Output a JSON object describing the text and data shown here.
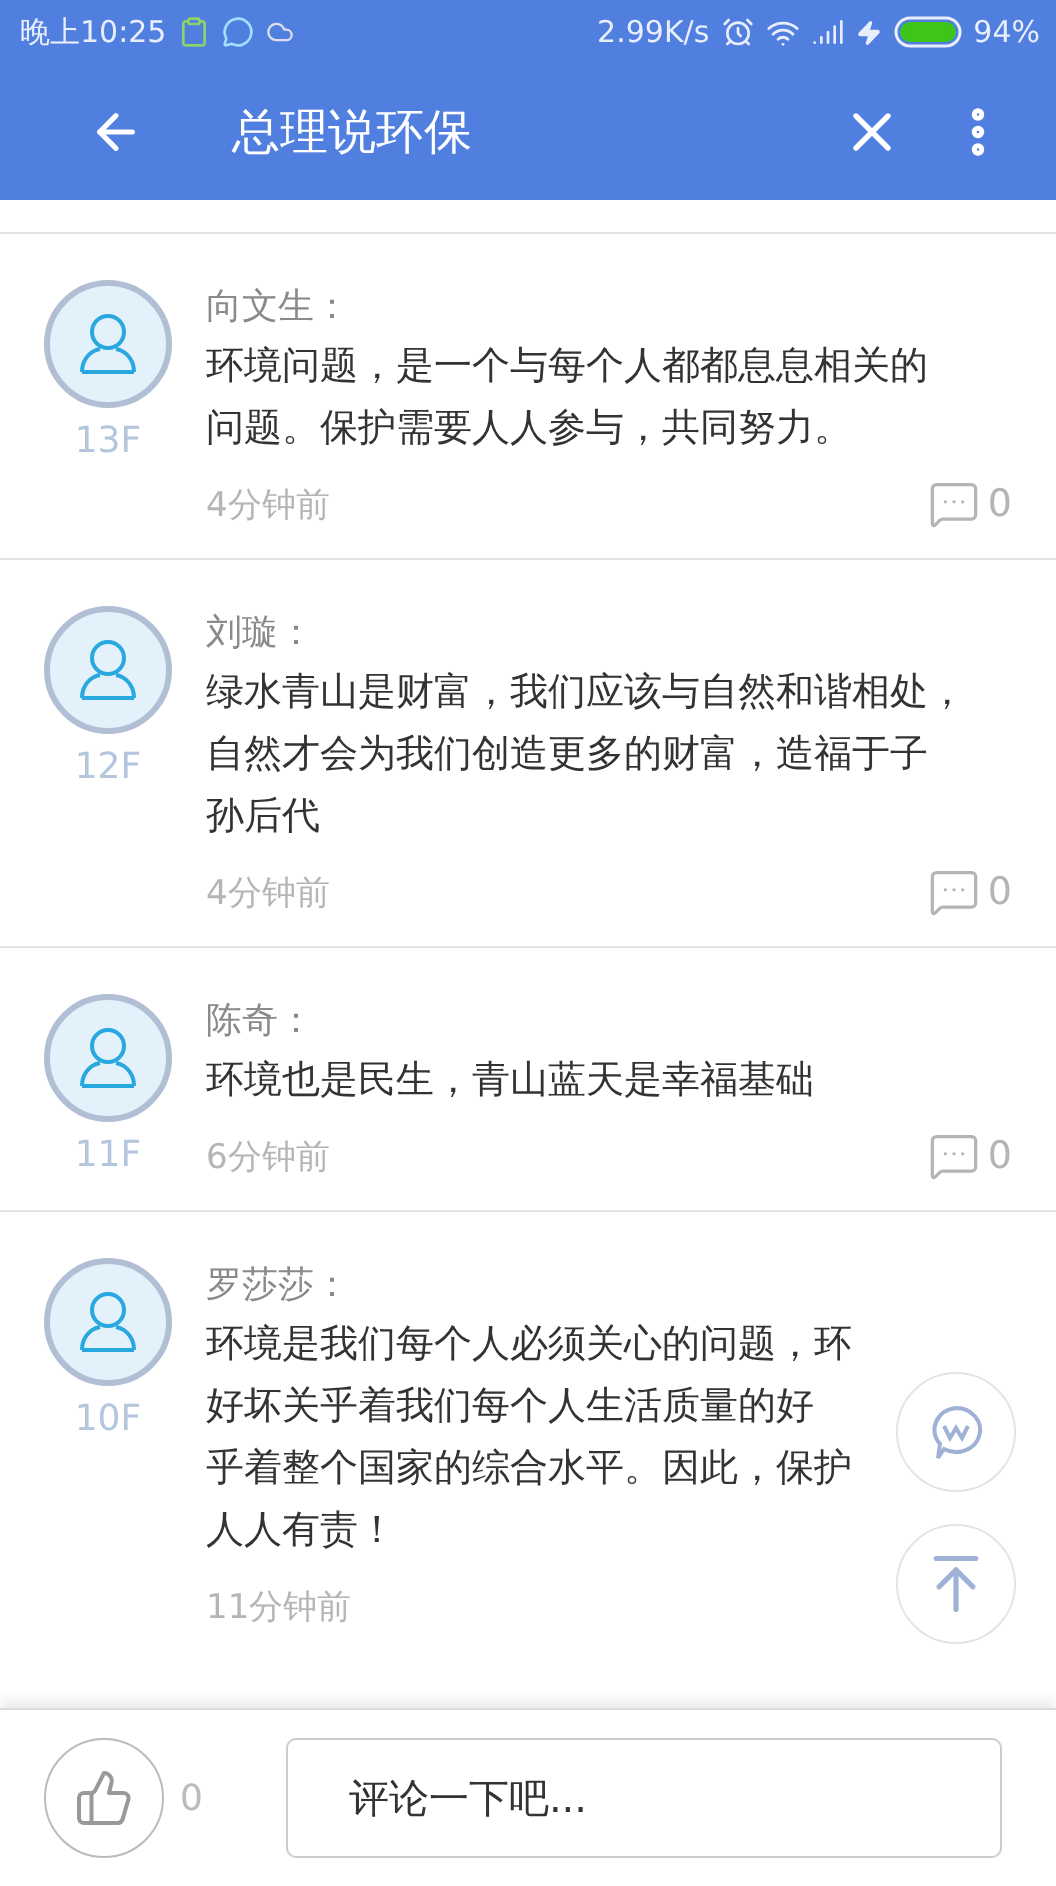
{
  "status_bar": {
    "time": "晚上10:25",
    "speed": "2.99K/s",
    "battery": "94%"
  },
  "app_bar": {
    "title": "总理说环保"
  },
  "comments": [
    {
      "user": "向文生：",
      "floor": "13F",
      "lines": [
        "环境问题，是一个与每个人都都息息相关的",
        "问题。保护需要人人参与，共同努力。"
      ],
      "time": "4分钟前",
      "replies": "0"
    },
    {
      "user": "刘璇：",
      "floor": "12F",
      "lines": [
        "绿水青山是财富，我们应该与自然和谐相处，",
        "自然才会为我们创造更多的财富，造福于子",
        "孙后代"
      ],
      "time": "4分钟前",
      "replies": "0"
    },
    {
      "user": "陈奇：",
      "floor": "11F",
      "lines": [
        "环境也是民生，青山蓝天是幸福基础"
      ],
      "time": "6分钟前",
      "replies": "0"
    },
    {
      "user": "罗莎莎：",
      "floor": "10F",
      "lines": [
        "环境是我们每个人必须关心的问题，环",
        "好坏关乎着我们每个人生活质量的好",
        "乎着整个国家的综合水平。因此，保护",
        "人人有责！"
      ],
      "time": "11分钟前"
    }
  ],
  "bottom_bar": {
    "likes": "0",
    "placeholder": "评论一下吧..."
  }
}
